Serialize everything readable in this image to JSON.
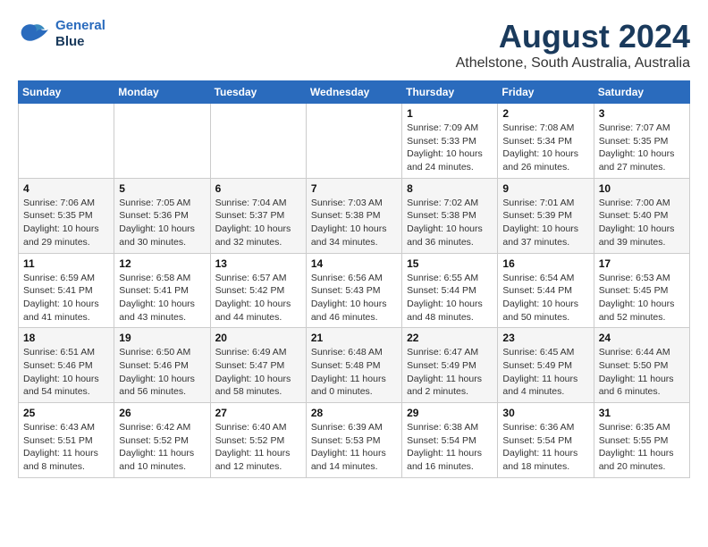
{
  "header": {
    "logo_line1": "General",
    "logo_line2": "Blue",
    "title": "August 2024",
    "subtitle": "Athelstone, South Australia, Australia"
  },
  "weekdays": [
    "Sunday",
    "Monday",
    "Tuesday",
    "Wednesday",
    "Thursday",
    "Friday",
    "Saturday"
  ],
  "weeks": [
    [
      {
        "day": "",
        "info": ""
      },
      {
        "day": "",
        "info": ""
      },
      {
        "day": "",
        "info": ""
      },
      {
        "day": "",
        "info": ""
      },
      {
        "day": "1",
        "info": "Sunrise: 7:09 AM\nSunset: 5:33 PM\nDaylight: 10 hours\nand 24 minutes."
      },
      {
        "day": "2",
        "info": "Sunrise: 7:08 AM\nSunset: 5:34 PM\nDaylight: 10 hours\nand 26 minutes."
      },
      {
        "day": "3",
        "info": "Sunrise: 7:07 AM\nSunset: 5:35 PM\nDaylight: 10 hours\nand 27 minutes."
      }
    ],
    [
      {
        "day": "4",
        "info": "Sunrise: 7:06 AM\nSunset: 5:35 PM\nDaylight: 10 hours\nand 29 minutes."
      },
      {
        "day": "5",
        "info": "Sunrise: 7:05 AM\nSunset: 5:36 PM\nDaylight: 10 hours\nand 30 minutes."
      },
      {
        "day": "6",
        "info": "Sunrise: 7:04 AM\nSunset: 5:37 PM\nDaylight: 10 hours\nand 32 minutes."
      },
      {
        "day": "7",
        "info": "Sunrise: 7:03 AM\nSunset: 5:38 PM\nDaylight: 10 hours\nand 34 minutes."
      },
      {
        "day": "8",
        "info": "Sunrise: 7:02 AM\nSunset: 5:38 PM\nDaylight: 10 hours\nand 36 minutes."
      },
      {
        "day": "9",
        "info": "Sunrise: 7:01 AM\nSunset: 5:39 PM\nDaylight: 10 hours\nand 37 minutes."
      },
      {
        "day": "10",
        "info": "Sunrise: 7:00 AM\nSunset: 5:40 PM\nDaylight: 10 hours\nand 39 minutes."
      }
    ],
    [
      {
        "day": "11",
        "info": "Sunrise: 6:59 AM\nSunset: 5:41 PM\nDaylight: 10 hours\nand 41 minutes."
      },
      {
        "day": "12",
        "info": "Sunrise: 6:58 AM\nSunset: 5:41 PM\nDaylight: 10 hours\nand 43 minutes."
      },
      {
        "day": "13",
        "info": "Sunrise: 6:57 AM\nSunset: 5:42 PM\nDaylight: 10 hours\nand 44 minutes."
      },
      {
        "day": "14",
        "info": "Sunrise: 6:56 AM\nSunset: 5:43 PM\nDaylight: 10 hours\nand 46 minutes."
      },
      {
        "day": "15",
        "info": "Sunrise: 6:55 AM\nSunset: 5:44 PM\nDaylight: 10 hours\nand 48 minutes."
      },
      {
        "day": "16",
        "info": "Sunrise: 6:54 AM\nSunset: 5:44 PM\nDaylight: 10 hours\nand 50 minutes."
      },
      {
        "day": "17",
        "info": "Sunrise: 6:53 AM\nSunset: 5:45 PM\nDaylight: 10 hours\nand 52 minutes."
      }
    ],
    [
      {
        "day": "18",
        "info": "Sunrise: 6:51 AM\nSunset: 5:46 PM\nDaylight: 10 hours\nand 54 minutes."
      },
      {
        "day": "19",
        "info": "Sunrise: 6:50 AM\nSunset: 5:46 PM\nDaylight: 10 hours\nand 56 minutes."
      },
      {
        "day": "20",
        "info": "Sunrise: 6:49 AM\nSunset: 5:47 PM\nDaylight: 10 hours\nand 58 minutes."
      },
      {
        "day": "21",
        "info": "Sunrise: 6:48 AM\nSunset: 5:48 PM\nDaylight: 11 hours\nand 0 minutes."
      },
      {
        "day": "22",
        "info": "Sunrise: 6:47 AM\nSunset: 5:49 PM\nDaylight: 11 hours\nand 2 minutes."
      },
      {
        "day": "23",
        "info": "Sunrise: 6:45 AM\nSunset: 5:49 PM\nDaylight: 11 hours\nand 4 minutes."
      },
      {
        "day": "24",
        "info": "Sunrise: 6:44 AM\nSunset: 5:50 PM\nDaylight: 11 hours\nand 6 minutes."
      }
    ],
    [
      {
        "day": "25",
        "info": "Sunrise: 6:43 AM\nSunset: 5:51 PM\nDaylight: 11 hours\nand 8 minutes."
      },
      {
        "day": "26",
        "info": "Sunrise: 6:42 AM\nSunset: 5:52 PM\nDaylight: 11 hours\nand 10 minutes."
      },
      {
        "day": "27",
        "info": "Sunrise: 6:40 AM\nSunset: 5:52 PM\nDaylight: 11 hours\nand 12 minutes."
      },
      {
        "day": "28",
        "info": "Sunrise: 6:39 AM\nSunset: 5:53 PM\nDaylight: 11 hours\nand 14 minutes."
      },
      {
        "day": "29",
        "info": "Sunrise: 6:38 AM\nSunset: 5:54 PM\nDaylight: 11 hours\nand 16 minutes."
      },
      {
        "day": "30",
        "info": "Sunrise: 6:36 AM\nSunset: 5:54 PM\nDaylight: 11 hours\nand 18 minutes."
      },
      {
        "day": "31",
        "info": "Sunrise: 6:35 AM\nSunset: 5:55 PM\nDaylight: 11 hours\nand 20 minutes."
      }
    ]
  ]
}
